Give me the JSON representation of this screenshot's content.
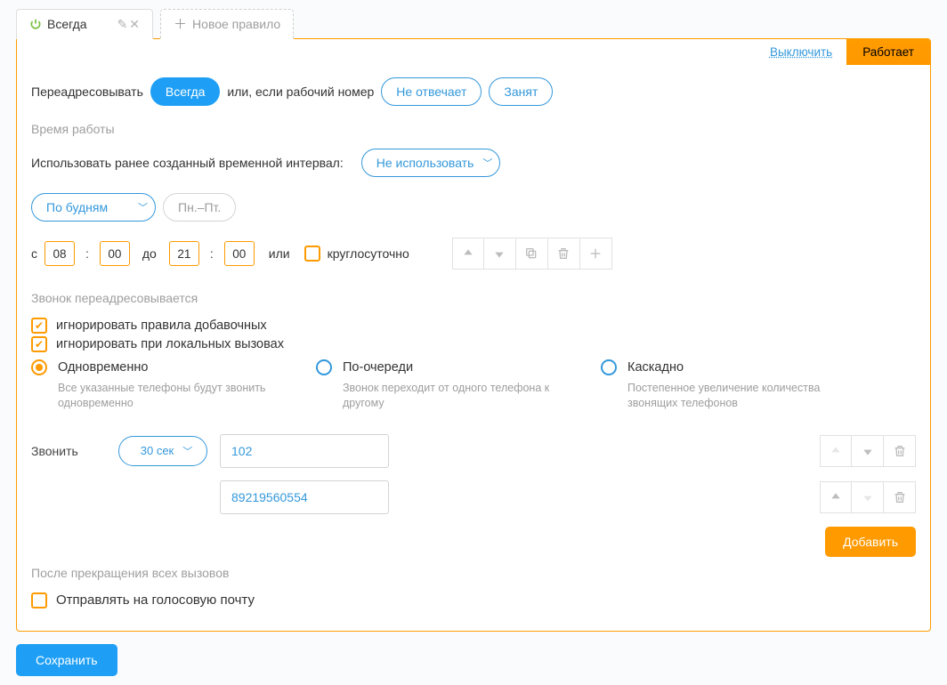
{
  "tabs": {
    "active": {
      "label": "Всегда"
    },
    "new": {
      "label": "Новое правило"
    }
  },
  "status": {
    "disable_link": "Выключить",
    "on_badge": "Работает"
  },
  "forward": {
    "label": "Переадресовывать",
    "always": "Всегда",
    "mid": "или, если рабочий номер",
    "no_answer": "Не отвечает",
    "busy": "Занят"
  },
  "worktime_header": "Время работы",
  "interval": {
    "label": "Использовать ранее созданный временной интервал:",
    "value": "Не использовать"
  },
  "daysel": {
    "value": "По будням",
    "hint": "Пн.–Пт."
  },
  "time": {
    "from_label": "с",
    "h1": "08",
    "m1": "00",
    "to": "до",
    "h2": "21",
    "m2": "00",
    "or": "или",
    "all_day": "круглосуточно"
  },
  "redirect_header": "Звонок переадресовывается",
  "chk_ignore_ext": "игнорировать правила добавочных",
  "chk_ignore_local": "игнорировать при локальных вызовах",
  "modes": {
    "a": {
      "title": "Одновременно",
      "desc": "Все указанные телефоны будут звонить одновременно"
    },
    "b": {
      "title": "По-очереди",
      "desc": "Звонок переходит от одного телефона к другому"
    },
    "c": {
      "title": "Каскадно",
      "desc": "Постепенное увеличение количества звонящих телефонов"
    }
  },
  "call": {
    "label": "Звонить",
    "duration": "30 сек",
    "n1": "102",
    "n2": "89219560554",
    "add": "Добавить"
  },
  "after_header": "После прекращения всех вызовов",
  "voicemail": "Отправлять на голосовую почту",
  "save": "Сохранить"
}
